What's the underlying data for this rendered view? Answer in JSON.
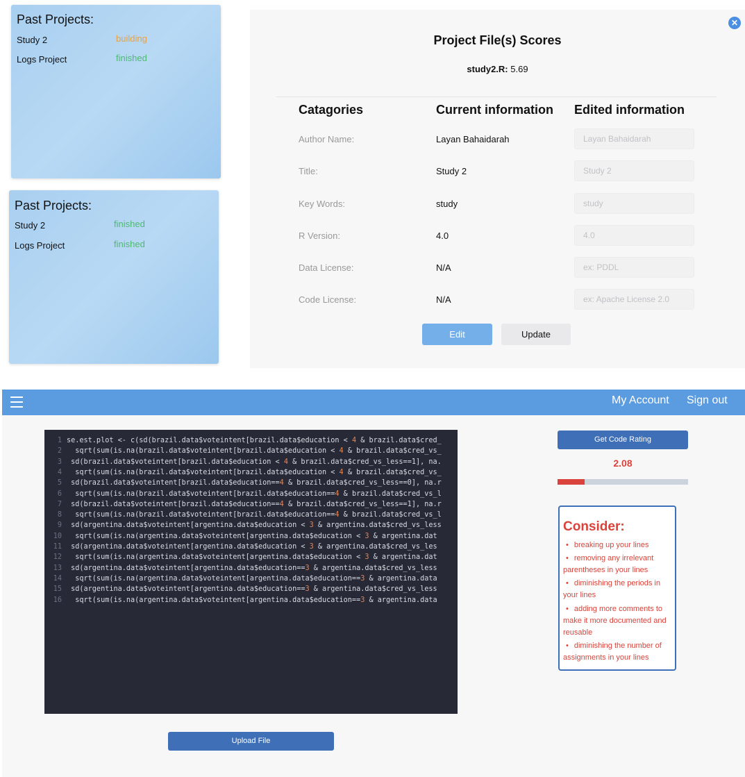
{
  "past_projects_cards": [
    {
      "title": "Past Projects:",
      "projects": [
        {
          "name": "Study 2",
          "status": "building",
          "status_color": "#e2a34b"
        },
        {
          "name": "Logs Project",
          "status": "finished",
          "status_color": "#4fb873"
        }
      ]
    },
    {
      "title": "Past Projects:",
      "projects": [
        {
          "name": "Study 2",
          "status": "finished",
          "status_color": "#4fb873"
        },
        {
          "name": "Logs Project",
          "status": "finished",
          "status_color": "#4fb873"
        }
      ]
    }
  ],
  "scores_modal": {
    "title": "Project File(s) Scores",
    "file_label": "study2.R:",
    "file_score": "5.69",
    "close_icon": "close-icon",
    "columns": [
      "Catagories",
      "Current information",
      "Edited information"
    ],
    "rows": [
      {
        "label": "Author Name:",
        "current": "Layan Bahaidarah",
        "input_value": "Layan Bahaidarah"
      },
      {
        "label": "Title:",
        "current": "Study 2",
        "input_value": "Study 2"
      },
      {
        "label": "Key Words:",
        "current": "study",
        "input_value": "study"
      },
      {
        "label": "R Version:",
        "current": "4.0",
        "input_value": "4.0"
      },
      {
        "label": "Data License:",
        "current": "N/A",
        "input_value": "ex: PDDL"
      },
      {
        "label": "Code License:",
        "current": "N/A",
        "input_value": "ex: Apache License 2.0"
      }
    ],
    "edit_label": "Edit",
    "update_label": "Update",
    "edit_color": "#74afe9"
  },
  "app_bar": {
    "menu_icon": "hamburger-menu-icon",
    "my_account": "My Account",
    "sign_out": "Sign out",
    "color": "#5b9be0"
  },
  "editor": {
    "lines": [
      [
        "1",
        "se.est.plot <- c(sd(brazil.data$voteintent[brazil.data$education < ",
        "4",
        " & brazil.data$cred_"
      ],
      [
        "2",
        "  sqrt(sum(is.na(brazil.data$voteintent[brazil.data$education < ",
        "4",
        " & brazil.data$cred_vs_"
      ],
      [
        "3",
        " sd(brazil.data$voteintent[brazil.data$education < ",
        "4",
        " & brazil.data$cred_vs_less==1], na."
      ],
      [
        "4",
        "  sqrt(sum(is.na(brazil.data$voteintent[brazil.data$education < ",
        "4",
        " & brazil.data$cred_vs_"
      ],
      [
        "5",
        " sd(brazil.data$voteintent[brazil.data$education==",
        "4",
        " & brazil.data$cred_vs_less==0], na.r"
      ],
      [
        "6",
        "  sqrt(sum(is.na(brazil.data$voteintent[brazil.data$education==",
        "4",
        " & brazil.data$cred_vs_l"
      ],
      [
        "7",
        " sd(brazil.data$voteintent[brazil.data$education==",
        "4",
        " & brazil.data$cred_vs_less==1], na.r"
      ],
      [
        "8",
        "  sqrt(sum(is.na(brazil.data$voteintent[brazil.data$education==",
        "4",
        " & brazil.data$cred_vs_l"
      ],
      [
        "9",
        " sd(argentina.data$voteintent[argentina.data$education < ",
        "3",
        " & argentina.data$cred_vs_less"
      ],
      [
        "10",
        "  sqrt(sum(is.na(argentina.data$voteintent[argentina.data$education < ",
        "3",
        " & argentina.dat"
      ],
      [
        "11",
        " sd(argentina.data$voteintent[argentina.data$education < ",
        "3",
        " & argentina.data$cred_vs_les"
      ],
      [
        "12",
        "  sqrt(sum(is.na(argentina.data$voteintent[argentina.data$education < ",
        "3",
        " & argentina.dat"
      ],
      [
        "13",
        " sd(argentina.data$voteintent[argentina.data$education==",
        "3",
        " & argentina.data$cred_vs_less"
      ],
      [
        "14",
        "  sqrt(sum(is.na(argentina.data$voteintent[argentina.data$education==",
        "3",
        " & argentina.data"
      ],
      [
        "15",
        " sd(argentina.data$voteintent[argentina.data$education==",
        "3",
        " & argentina.data$cred_vs_less"
      ],
      [
        "16",
        "  sqrt(sum(is.na(argentina.data$voteintent[argentina.data$education==",
        "3",
        " & argentina.data"
      ]
    ],
    "background": "#272a36",
    "number_color": "#e0875b"
  },
  "upload_label": "Upload File",
  "rating": {
    "button_label": "Get Code Rating",
    "score": "2.08",
    "progress_fraction": 0.21,
    "color": "#d9433b"
  },
  "consider": {
    "title": "Consider:",
    "tips": [
      "breaking up your lines",
      "removing any irrelevant parentheses in your lines",
      "diminishing the periods in your lines",
      "adding more comments to make it more documented and reusable",
      "diminishing the number of assignments in your lines"
    ]
  }
}
